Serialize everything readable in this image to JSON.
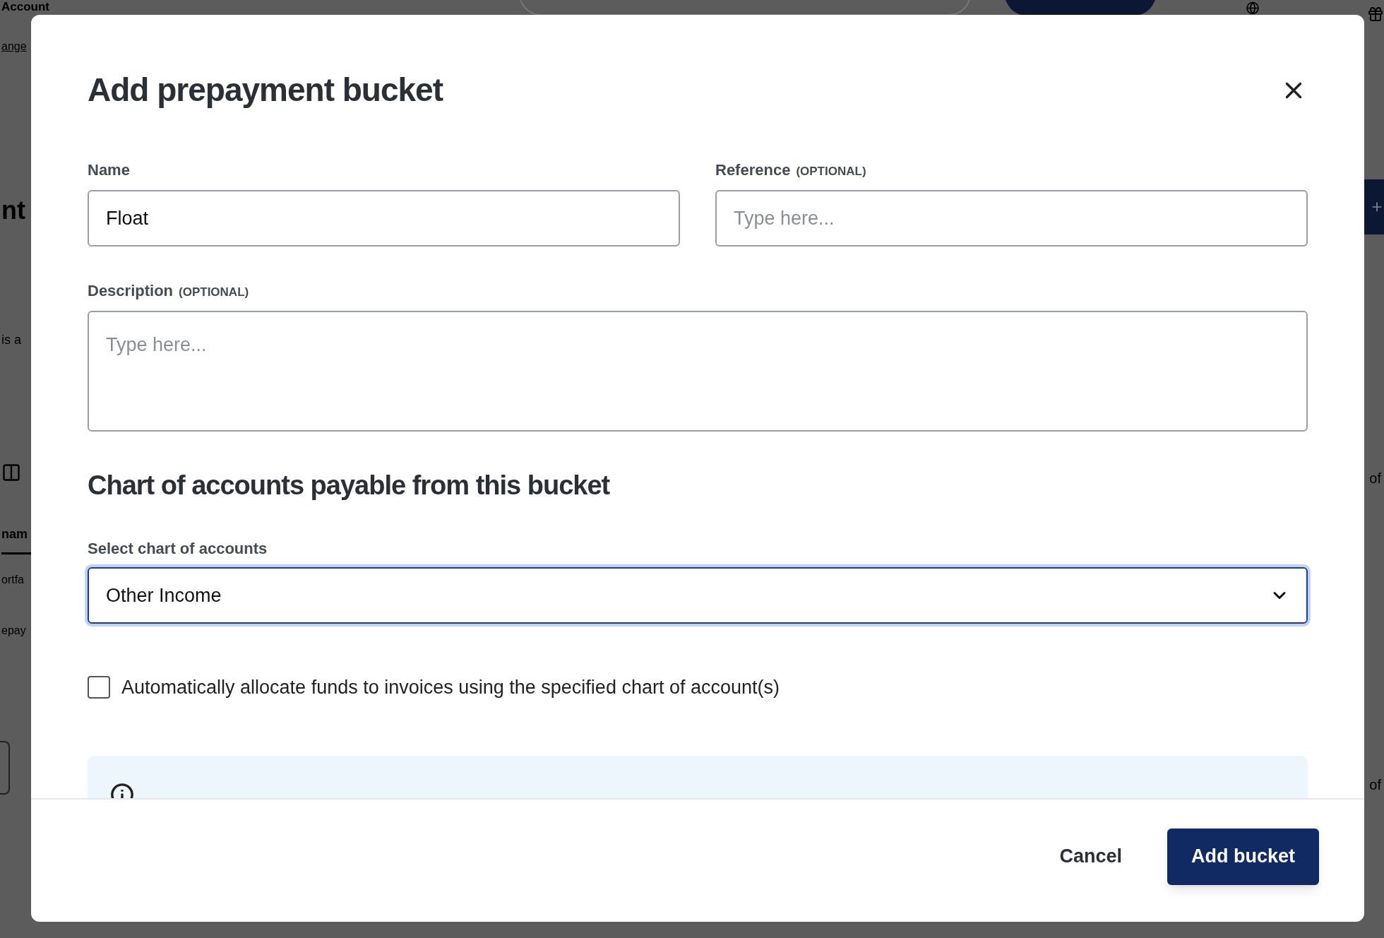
{
  "background": {
    "heading": "Account",
    "link": "ange",
    "section_title": "nt",
    "text": "is a",
    "column_header": "nam",
    "rows": [
      "ortfa",
      "epay"
    ],
    "right_texts": [
      "of",
      "of"
    ]
  },
  "modal": {
    "title": "Add prepayment bucket",
    "fields": [
      {
        "label": "Name",
        "value": "Float"
      },
      {
        "label": "Reference",
        "optional": "(OPTIONAL)",
        "placeholder": "Type here..."
      }
    ],
    "description": {
      "label": "Description",
      "optional": "(OPTIONAL)",
      "placeholder": "Type here..."
    },
    "section_title": "Chart of accounts payable from this bucket",
    "select": {
      "label": "Select chart of accounts",
      "value": "Other Income",
      "focused": true
    },
    "checkbox": {
      "label": "Automatically allocate funds to invoices using the specified chart of account(s)",
      "checked": false
    },
    "buttons": [
      {
        "label": "Cancel",
        "kind": "secondary"
      },
      {
        "label": "Add bucket",
        "kind": "primary"
      }
    ]
  }
}
